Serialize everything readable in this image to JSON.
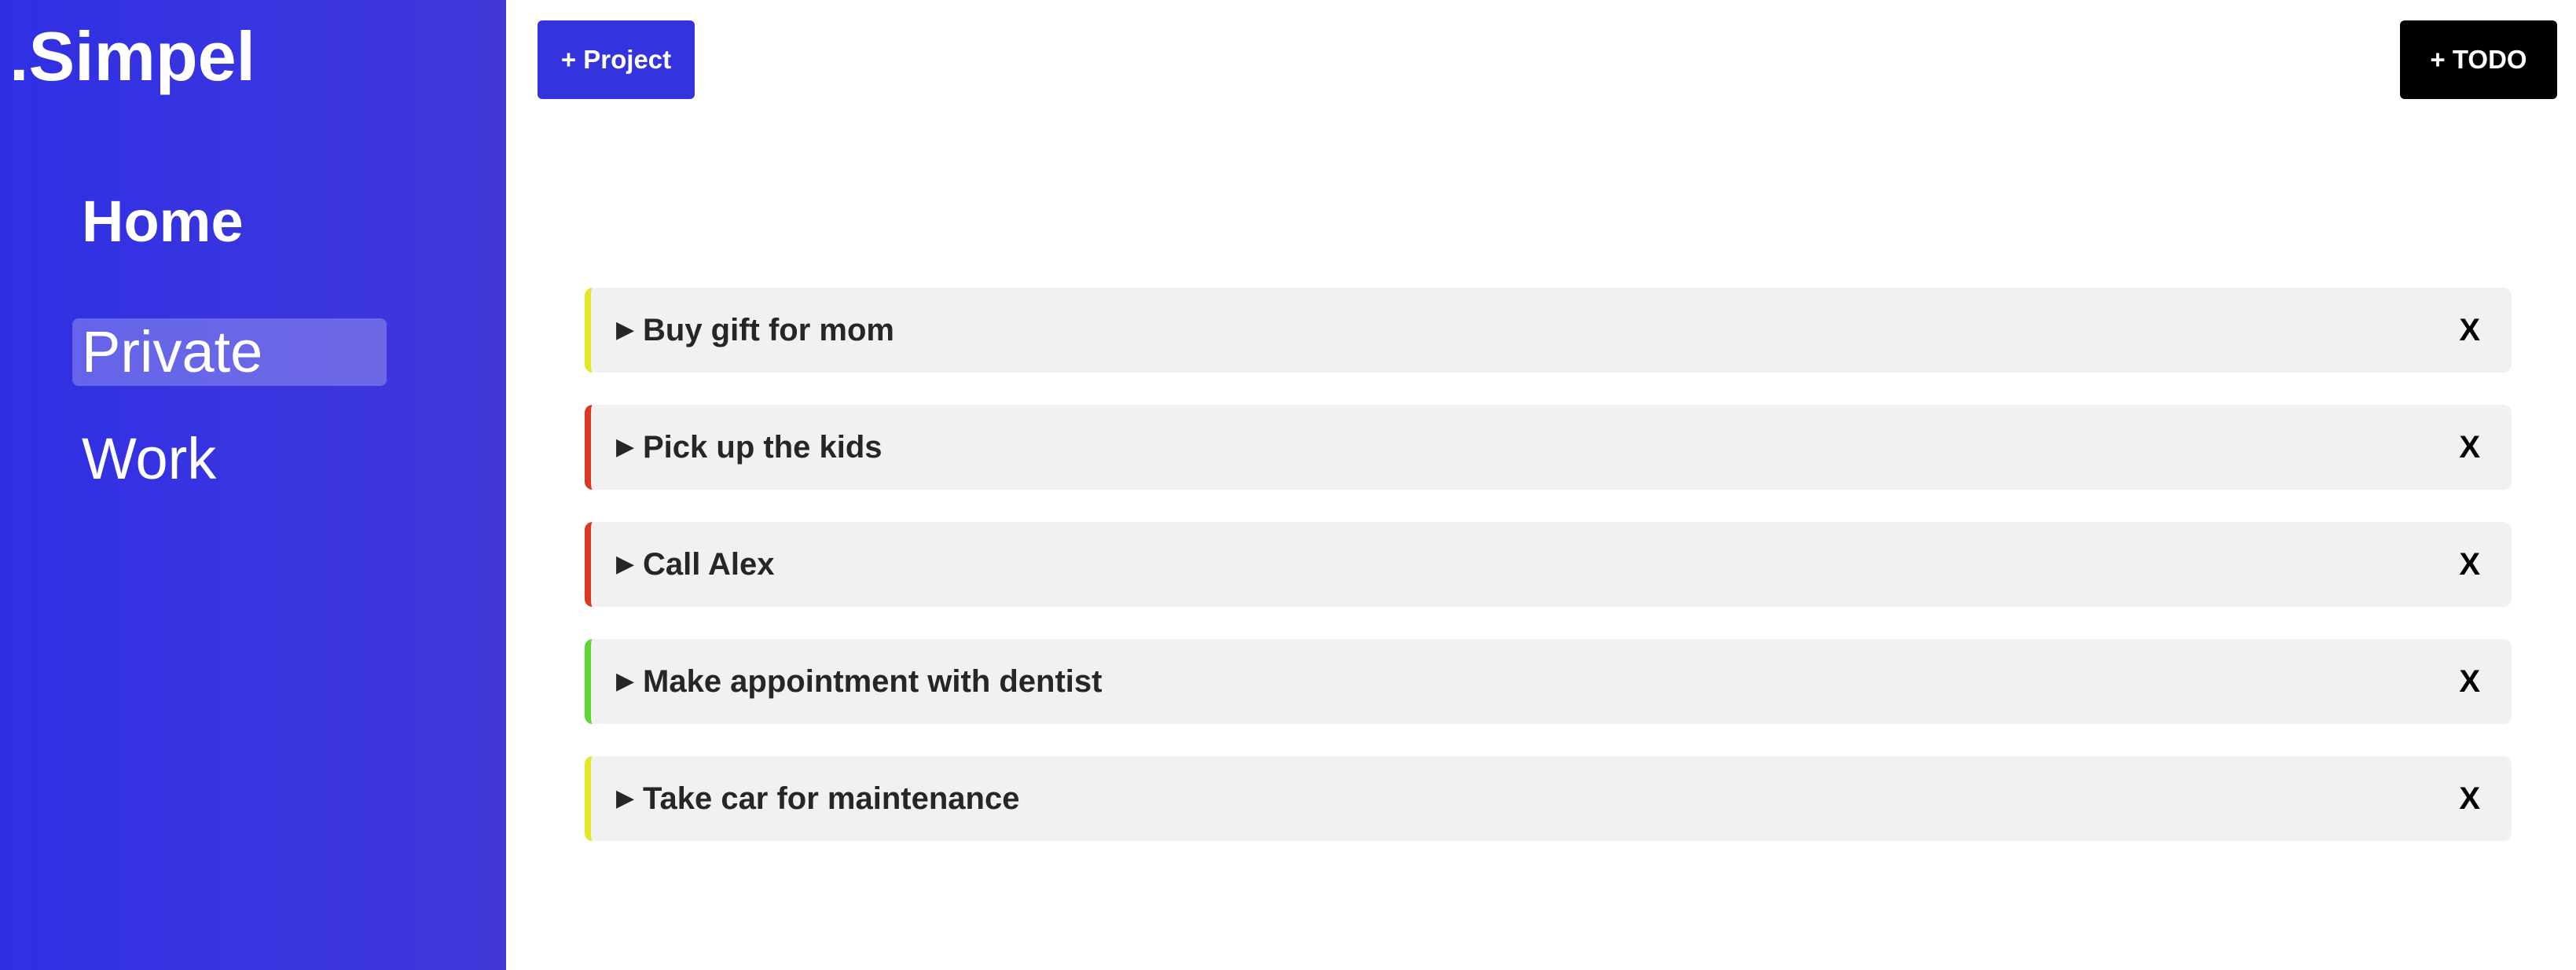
{
  "app": {
    "logo": ".Simpel"
  },
  "sidebar": {
    "home_label": "Home",
    "projects": [
      {
        "label": "Private",
        "active": true
      },
      {
        "label": "Work",
        "active": false
      }
    ]
  },
  "toolbar": {
    "add_project_label": "+ Project",
    "add_todo_label": "+ TODO"
  },
  "todos": [
    {
      "title": "Buy gift for mom",
      "priority_color": "#e5e52a",
      "expand_icon": "caret-right-icon",
      "delete_label": "X"
    },
    {
      "title": "Pick up the kids",
      "priority_color": "#d93a25",
      "expand_icon": "caret-right-icon",
      "delete_label": "X"
    },
    {
      "title": "Call Alex",
      "priority_color": "#d93a25",
      "expand_icon": "caret-right-icon",
      "delete_label": "X"
    },
    {
      "title": "Make appointment with dentist",
      "priority_color": "#5fd633",
      "expand_icon": "caret-right-icon",
      "delete_label": "X"
    },
    {
      "title": "Take car for maintenance",
      "priority_color": "#e5e52a",
      "expand_icon": "caret-right-icon",
      "delete_label": "X"
    }
  ],
  "colors": {
    "sidebar_start": "#2f30e4",
    "sidebar_end": "#4238da",
    "project_button": "#3434df",
    "todo_button": "#000000",
    "todo_background": "#f1f1f1"
  }
}
